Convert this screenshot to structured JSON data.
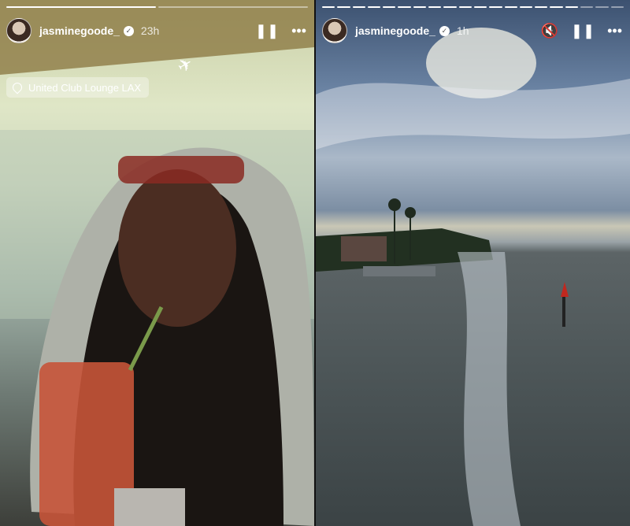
{
  "left_story": {
    "username": "jasminegoode_",
    "time": "23h",
    "location": "United Club Lounge LAX",
    "segments": 2,
    "current_segment": 1
  },
  "right_story": {
    "username": "jasminegoode_",
    "time": "1h",
    "segments": 20,
    "current_segment": 17
  },
  "icons": {
    "verified": "verified-badge-icon",
    "pause": "pause-icon",
    "more": "more-icon",
    "mute": "mute-icon",
    "location": "location-pin-icon",
    "plane": "airplane-icon"
  },
  "glyphs": {
    "verified": "✓",
    "pause": "❚❚",
    "more": "•••",
    "mute": "🔇",
    "plane": "✈"
  }
}
